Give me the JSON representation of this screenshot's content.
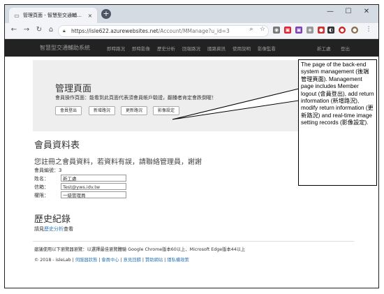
{
  "browser": {
    "tab_title": "管理頁面 - 智慧型交通輔助系統",
    "tab_close": "×",
    "new_tab": "+",
    "url_main": "https://isle622.azurewebsites.net",
    "url_path": "/Account/MManage?u_id=3",
    "window_controls": {
      "minimize": "—",
      "maximize": "☐",
      "close": "✕"
    }
  },
  "site_nav": {
    "brand": "智慧型交通輔助系統",
    "links": [
      "即時路況",
      "即時影像",
      "歷史分析",
      "回報路況",
      "國路資訊",
      "使用說明",
      "影像監看"
    ],
    "user": "新工處",
    "logout": "登出"
  },
  "jumbotron": {
    "title": "管理頁面",
    "lead": "會員操作頁面：能看到此頁面代表須會員帳戶驗證，翻播者肯定會跌倒喔！",
    "buttons": [
      "會員登出",
      "新增路況",
      "更新路況",
      "影像設定"
    ]
  },
  "member": {
    "heading": "會員資料表",
    "intro": "您註冊之會員資料，若資料有誤，請聯絡管理員，謝謝",
    "id_label": "會員編號：",
    "id_value": "3",
    "name_label": "姓名：",
    "name_value": "新工處",
    "email_label": "信箱：",
    "email_value": "Test@yws.idv.tw",
    "role_label": "權限：",
    "role_value": "一級管理員"
  },
  "history": {
    "heading": "歷史紀錄",
    "text_before": "請見",
    "link": "歷史分析",
    "text_after": "查看"
  },
  "footer": {
    "note": "建議使用以下瀏覽器瀏覽：以選擇最佳瀏覽體驗 Google Chrome版本60以上、Microsoft Edge版本44以上",
    "copyright": "© 2018 - isleLab",
    "links": [
      "伺服器狀態",
      "會員中心",
      "意見回饋",
      "贊助網站",
      "隱私權政策"
    ]
  },
  "callout": {
    "text": "The page of the back-end system management (後端管理頁面). Management page includes Member logout (會員登出), add return information (新增路況), modify return information (更新路況) and real-time image setting records (影像設定)."
  }
}
